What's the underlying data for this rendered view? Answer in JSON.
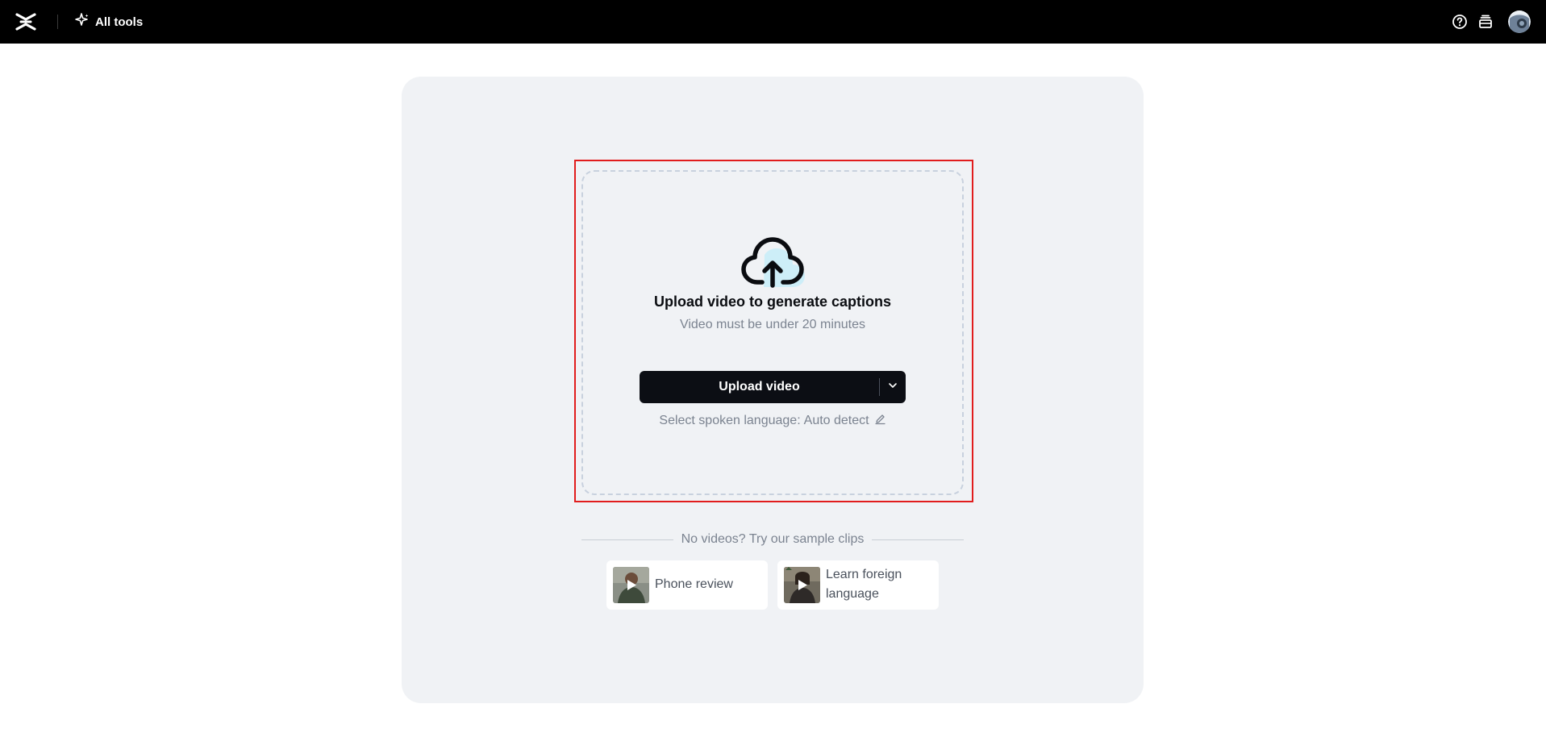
{
  "topbar": {
    "all_tools_label": "All tools"
  },
  "upload": {
    "title": "Upload video to generate captions",
    "subtitle": "Video must be under 20 minutes",
    "button_label": "Upload video",
    "language_prefix": "Select spoken language:",
    "language_value": "Auto detect"
  },
  "samples": {
    "heading": "No videos? Try our sample clips",
    "items": [
      {
        "label": "Phone review",
        "icon": "play-icon"
      },
      {
        "label": "Learn foreign language",
        "icon": "play-icon"
      }
    ]
  },
  "colors": {
    "topbar_bg": "#000000",
    "panel_bg": "#f0f2f5",
    "button_bg": "#0c0e14",
    "highlight": "#e11d1d",
    "cloud_accent": "#cdeef8"
  }
}
